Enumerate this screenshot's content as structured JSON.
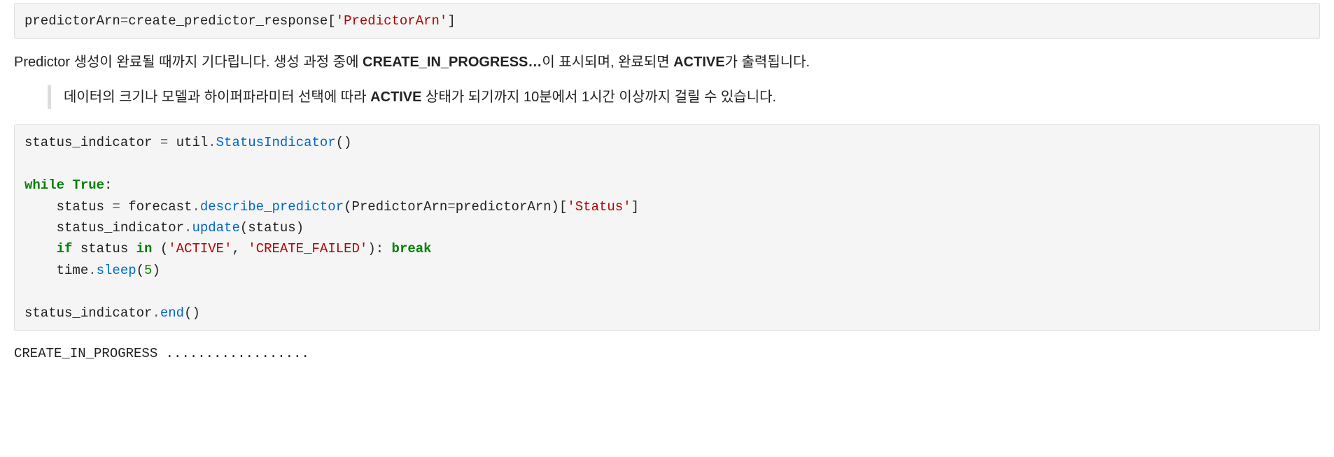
{
  "code1": {
    "line1_a": "predictorArn",
    "line1_b": "=",
    "line1_c": "create_predictor_response[",
    "line1_d": "'PredictorArn'",
    "line1_e": "]"
  },
  "prose1": {
    "before1": "Predictor 생성이 완료될 때까지 기다립니다. 생성 과정 중에 ",
    "bold1": "CREATE_IN_PROGRESS…",
    "mid1": "이 표시되며, 완료되면 ",
    "bold2": "ACTIVE",
    "after2": "가 출력됩니다."
  },
  "quote1": {
    "before": "데이터의 크기나 모델과 하이퍼파라미터 선택에 따라 ",
    "bold": "ACTIVE",
    "after": " 상태가 되기까지 10분에서 1시간 이상까지 걸릴 수 있습니다."
  },
  "code2": {
    "l1_a": "status_indicator ",
    "l1_b": "=",
    "l1_c": " util",
    "l1_d": ".",
    "l1_e": "StatusIndicator",
    "l1_f": "()",
    "blank": "",
    "l3_a": "while",
    "l3_b": " ",
    "l3_c": "True",
    "l3_d": ":",
    "l4_a": "    status ",
    "l4_b": "=",
    "l4_c": " forecast",
    "l4_d": ".",
    "l4_e": "describe_predictor",
    "l4_f": "(PredictorArn",
    "l4_g": "=",
    "l4_h": "predictorArn)[",
    "l4_i": "'Status'",
    "l4_j": "]",
    "l5_a": "    status_indicator",
    "l5_b": ".",
    "l5_c": "update",
    "l5_d": "(status)",
    "l6_a": "    ",
    "l6_b": "if",
    "l6_c": " status ",
    "l6_d": "in",
    "l6_e": " (",
    "l6_f": "'ACTIVE'",
    "l6_g": ", ",
    "l6_h": "'CREATE_FAILED'",
    "l6_i": "): ",
    "l6_j": "break",
    "l7_a": "    time",
    "l7_b": ".",
    "l7_c": "sleep",
    "l7_d": "(",
    "l7_e": "5",
    "l7_f": ")",
    "l9_a": "status_indicator",
    "l9_b": ".",
    "l9_c": "end",
    "l9_d": "()"
  },
  "output1": "CREATE_IN_PROGRESS .................."
}
